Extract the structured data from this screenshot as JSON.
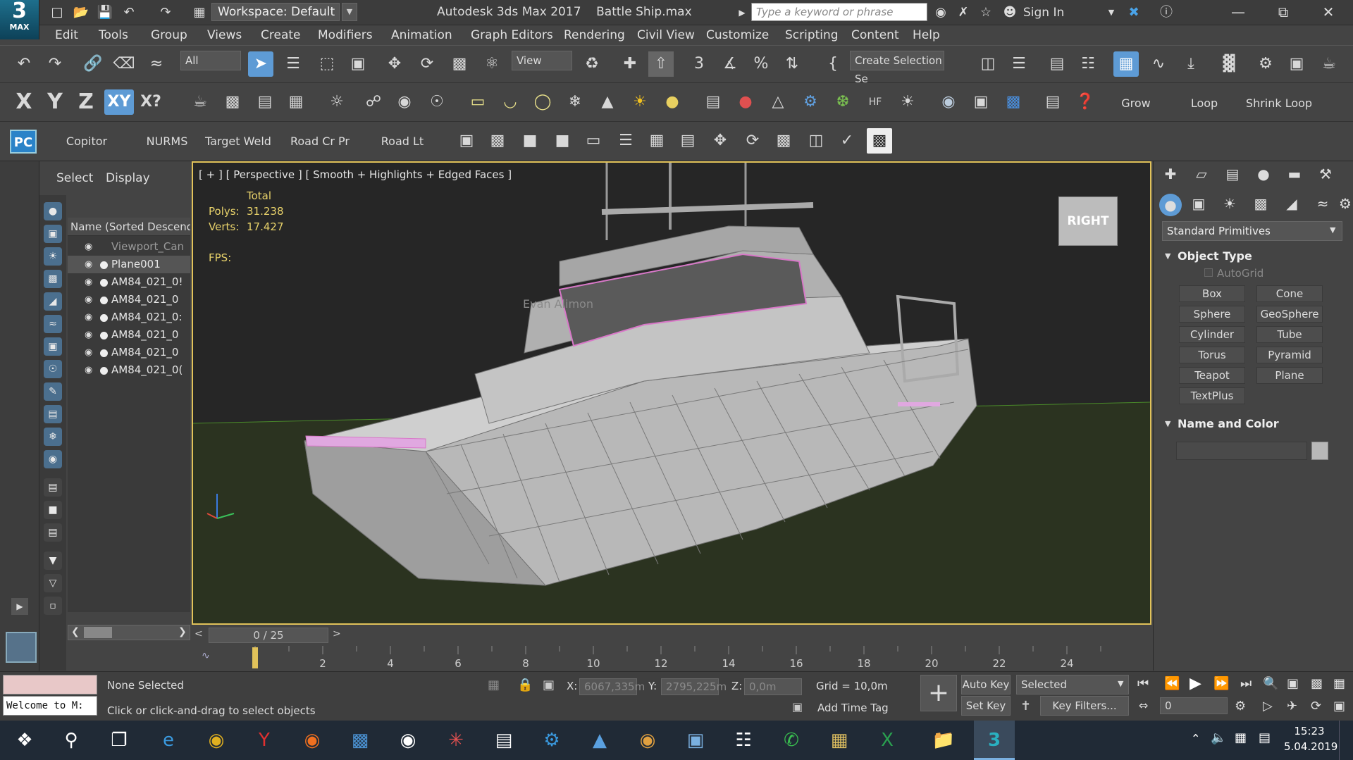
{
  "window": {
    "app_name": "Autodesk 3ds Max 2017",
    "file_name": "Battle Ship.max",
    "workspace": "Workspace: Default",
    "search_placeholder": "Type a keyword or phrase",
    "sign_in": "Sign In",
    "logo_number": "3",
    "logo_text": "MAX"
  },
  "menu": [
    "Edit",
    "Tools",
    "Group",
    "Views",
    "Create",
    "Modifiers",
    "Animation",
    "Graph Editors",
    "Rendering",
    "Civil View",
    "Customize",
    "Scripting",
    "Content",
    "Help"
  ],
  "toolbar": {
    "selection_filter": "All",
    "reference_coord": "View",
    "named_selection": "Create Selection Se"
  },
  "axis_toolbar": {
    "x": "X",
    "y": "Y",
    "z": "Z",
    "xy": "XY",
    "xq": "X?",
    "grow": "Grow",
    "loop": "Loop",
    "shrink_loop": "Shrink Loop"
  },
  "ribbon": {
    "pc_label": "PC",
    "copitor": "Copitor",
    "nurms": "NURMS",
    "target_weld": "Target Weld",
    "road_cr_pr": "Road Cr Pr",
    "road_lt": "Road Lt"
  },
  "scene_explorer": {
    "tab_select": "Select",
    "tab_display": "Display",
    "column_header": "Name (Sorted Descendin",
    "items": [
      {
        "name": "Viewport_Can",
        "dim": true
      },
      {
        "name": "Plane001",
        "dim": false
      },
      {
        "name": "AM84_021_0!",
        "dim": false
      },
      {
        "name": "AM84_021_0",
        "dim": false
      },
      {
        "name": "AM84_021_0:",
        "dim": false
      },
      {
        "name": "AM84_021_0",
        "dim": false
      },
      {
        "name": "AM84_021_0",
        "dim": false
      },
      {
        "name": "AM84_021_0(",
        "dim": false
      }
    ]
  },
  "viewport": {
    "label": "[ + ] [ Perspective ] [ Smooth + Highlights + Edged Faces ]",
    "stats_total": "Total",
    "polys_label": "Polys:",
    "polys_value": "31.238",
    "verts_label": "Verts:",
    "verts_value": "17.427",
    "fps_label": "FPS:",
    "viewcube_label": "RIGHT",
    "watermark": "Evan Alimon"
  },
  "command_panel": {
    "category": "Standard Primitives",
    "object_type_title": "Object Type",
    "autogrid": "AutoGrid",
    "primitives": [
      "Box",
      "Cone",
      "Sphere",
      "GeoSphere",
      "Cylinder",
      "Tube",
      "Torus",
      "Pyramid",
      "Teapot",
      "Plane",
      "TextPlus"
    ],
    "name_color_title": "Name and Color",
    "object_color": "#b8b8b8"
  },
  "timeline": {
    "frame_display": "0 / 25",
    "ticks": [
      "2",
      "4",
      "6",
      "8",
      "10",
      "12",
      "14",
      "16",
      "18",
      "20",
      "22",
      "24"
    ],
    "current_frame_marker": "0",
    "total_frames": 25
  },
  "status": {
    "welcome": "Welcome to M:",
    "selection": "None Selected",
    "prompt": "Click or click-and-drag to select objects",
    "x_label": "X:",
    "x_value": "6067,335m",
    "y_label": "Y:",
    "y_value": "2795,225m",
    "z_label": "Z:",
    "z_value": "0,0m",
    "grid": "Grid = 10,0m",
    "add_time_tag": "Add Time Tag",
    "auto_key": "Auto Key",
    "set_key": "Set Key",
    "selected": "Selected",
    "key_filters": "Key Filters...",
    "frame_spinner": "0"
  },
  "taskbar": {
    "time": "15:23",
    "date": "5.04.2019"
  },
  "colors": {
    "viewport_border": "#e1c25a",
    "stats_text": "#e8d26a",
    "ground": "#2b3320",
    "active_blue": "#5e9bd5"
  }
}
